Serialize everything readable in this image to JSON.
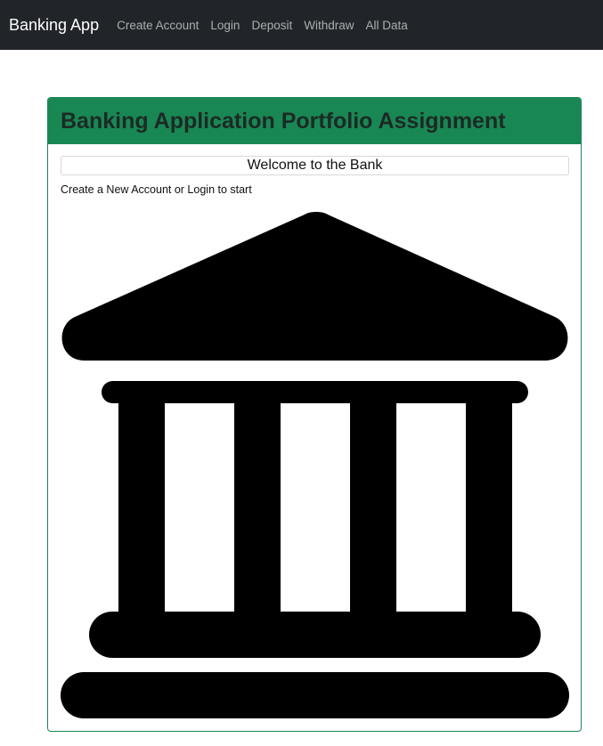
{
  "navbar": {
    "brand": "Banking App",
    "links": [
      {
        "label": "Create Account"
      },
      {
        "label": "Login"
      },
      {
        "label": "Deposit"
      },
      {
        "label": "Withdraw"
      },
      {
        "label": "All Data"
      }
    ]
  },
  "card": {
    "header": "Banking Application Portfolio Assignment",
    "welcome": "Welcome to the Bank",
    "subtitle": "Create a New Account or Login to start",
    "image_icon": "bank-building-icon",
    "accent_color": "#198754"
  }
}
